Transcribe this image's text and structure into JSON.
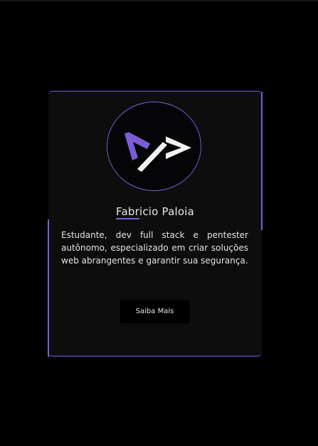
{
  "profile": {
    "name_first_part": "Fabr",
    "name_rest": "icio Paloia",
    "bio": "Estudante, dev full stack e pentester autônomo, especializado em criar soluções web abrangentes e garantir sua segurança.",
    "button_label": "Saiba Mais",
    "logo_icon": "code-brackets-icon"
  },
  "colors": {
    "background": "#000000",
    "card": "#0d0d0e",
    "accent": "#7b5cd6",
    "text": "#e4e4e4"
  }
}
